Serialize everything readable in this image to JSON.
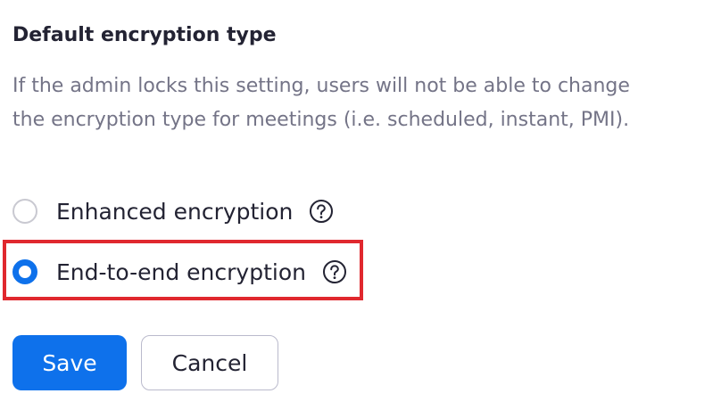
{
  "section": {
    "title": "Default encryption type",
    "description_lines": [
      "If the admin locks this setting, users will not be able to change",
      "the encryption type for meetings (i.e. scheduled, instant, PMI)."
    ]
  },
  "options": [
    {
      "label": "Enhanced encryption",
      "selected": false,
      "icon": "question-circle-icon"
    },
    {
      "label": "End-to-end encryption",
      "selected": true,
      "icon": "question-circle-icon",
      "highlighted": true
    }
  ],
  "buttons": {
    "save_label": "Save",
    "cancel_label": "Cancel"
  },
  "colors": {
    "primary": "#0e71eb",
    "highlight": "#e0282e",
    "title_text": "#232333",
    "description_text": "#747487"
  }
}
